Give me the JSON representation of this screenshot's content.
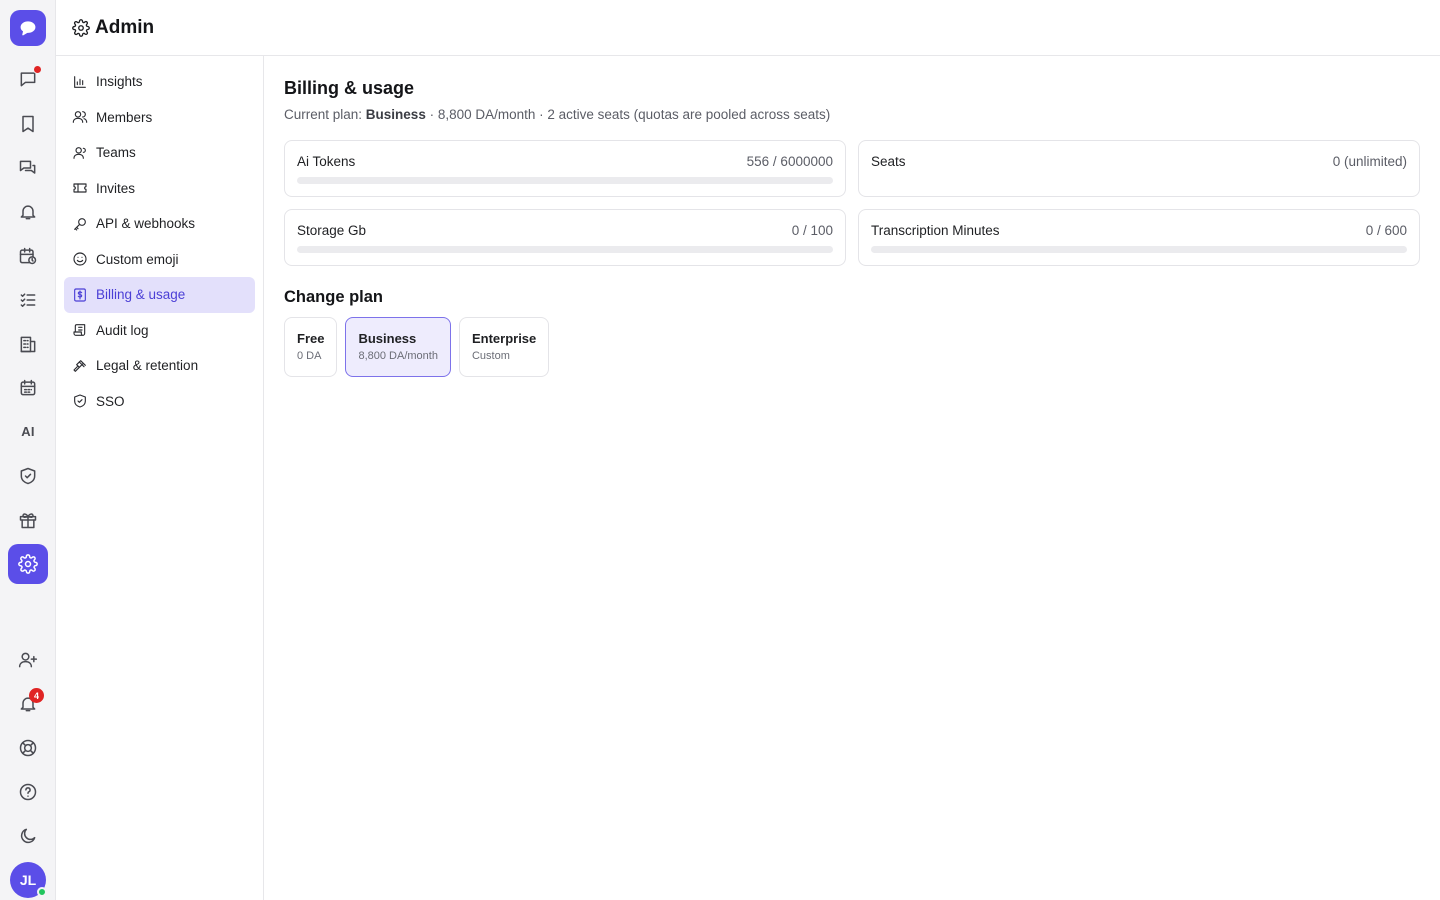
{
  "header": {
    "title": "Admin"
  },
  "rail": {
    "items": [
      {
        "name": "chats-icon",
        "badge_dot": true
      },
      {
        "name": "bookmark-icon"
      },
      {
        "name": "threads-icon"
      },
      {
        "name": "bell-icon"
      },
      {
        "name": "calendar-clock-icon"
      },
      {
        "name": "tasks-icon"
      },
      {
        "name": "building-icon"
      },
      {
        "name": "calendar-icon"
      },
      {
        "name": "ai-icon",
        "text": "AI"
      },
      {
        "name": "shield-check-icon"
      },
      {
        "name": "gift-icon"
      },
      {
        "name": "gear-icon",
        "active": true
      }
    ],
    "bottom": [
      {
        "name": "add-user-icon"
      },
      {
        "name": "notifications-icon",
        "badge": "4"
      },
      {
        "name": "lifebuoy-icon"
      },
      {
        "name": "help-icon"
      },
      {
        "name": "moon-icon"
      }
    ],
    "avatar_initials": "JL",
    "accent": "#5b4ee8"
  },
  "sidebar": {
    "items": [
      {
        "label": "Insights",
        "icon": "bar-chart-icon"
      },
      {
        "label": "Members",
        "icon": "users-icon"
      },
      {
        "label": "Teams",
        "icon": "team-icon"
      },
      {
        "label": "Invites",
        "icon": "ticket-icon"
      },
      {
        "label": "API & webhooks",
        "icon": "key-icon"
      },
      {
        "label": "Custom emoji",
        "icon": "smile-icon"
      },
      {
        "label": "Billing & usage",
        "icon": "dollar-file-icon",
        "active": true
      },
      {
        "label": "Audit log",
        "icon": "scroll-icon"
      },
      {
        "label": "Legal & retention",
        "icon": "gavel-icon"
      },
      {
        "label": "SSO",
        "icon": "shield-icon"
      }
    ]
  },
  "main": {
    "title": "Billing & usage",
    "plan_prefix": "Current plan: ",
    "plan_name": "Business",
    "plan_suffix": " · 8,800 DA/month · 2 active seats (quotas are pooled across seats)",
    "usage": [
      {
        "label": "Ai Tokens",
        "value": "556 / 6000000",
        "fraction": 9.27e-05,
        "has_bar": true
      },
      {
        "label": "Seats",
        "value": "0 (unlimited)",
        "has_bar": false
      },
      {
        "label": "Storage Gb",
        "value": "0 / 100",
        "fraction": 0,
        "has_bar": true
      },
      {
        "label": "Transcription Minutes",
        "value": "0 / 600",
        "fraction": 0,
        "has_bar": true
      }
    ],
    "change_plan_title": "Change plan",
    "plans": [
      {
        "name": "Free",
        "price": "0 DA",
        "selected": false
      },
      {
        "name": "Business",
        "price": "8,800 DA/month",
        "selected": true
      },
      {
        "name": "Enterprise",
        "price": "Custom",
        "selected": false
      }
    ]
  }
}
